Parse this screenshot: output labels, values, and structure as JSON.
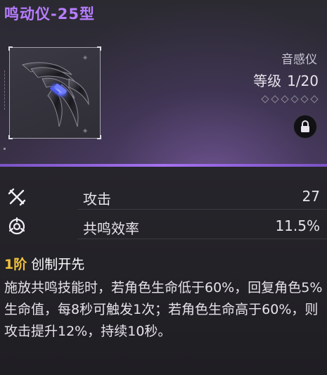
{
  "item": {
    "name": "鸣动仪-25型",
    "type": "音感仪",
    "level_word": "等级",
    "level_value": "1/20",
    "level_pips": 6,
    "locked": true,
    "icon": "resonator-weapon-icon"
  },
  "stats": [
    {
      "icon": "attack-icon",
      "label": "攻击",
      "value": "27"
    },
    {
      "icon": "energy-regen-icon",
      "label": "共鸣效率",
      "value": "11.5%"
    }
  ],
  "effect": {
    "rank": "1阶",
    "name": "创制开先",
    "description": "施放共鸣技能时，若角色生命低于60%，回复角色5%生命值，每8秒可触发1次；若角色生命高于60%，则攻击提升12%，持续10秒。"
  },
  "colors": {
    "title": "#b77dff",
    "rank": "#f2c23c",
    "divider": "#a571f0"
  }
}
